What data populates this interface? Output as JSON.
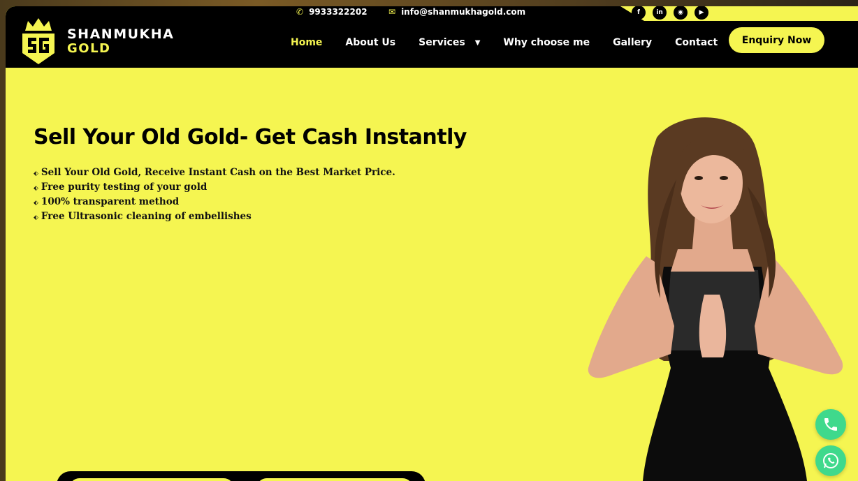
{
  "header": {
    "phone": "9933322202",
    "email": "info@shanmukhagold.com",
    "logo": {
      "line1": "SHANMUKHA",
      "line2": "GOLD",
      "mark": "SG"
    },
    "nav": [
      {
        "label": "Home"
      },
      {
        "label": "About Us"
      },
      {
        "label": "Services"
      },
      {
        "label": "Why choose me"
      },
      {
        "label": "Gallery"
      },
      {
        "label": "Contact"
      }
    ],
    "enquiry_label": "Enquiry Now",
    "socials": [
      "facebook-icon",
      "linkedin-icon",
      "instagram-icon",
      "youtube-icon"
    ]
  },
  "hero": {
    "title": "Sell Your Old Gold- Get Cash Instantly",
    "bullets": [
      "Sell Your Old Gold, Receive Instant Cash on the Best Market Price.",
      "Free purity testing of your gold",
      "100% transparent method",
      "Free Ultrasonic cleaning of embellishes"
    ]
  },
  "colors": {
    "accent": "#f5f551",
    "dark": "#000000",
    "fab": "#3fd98c"
  }
}
